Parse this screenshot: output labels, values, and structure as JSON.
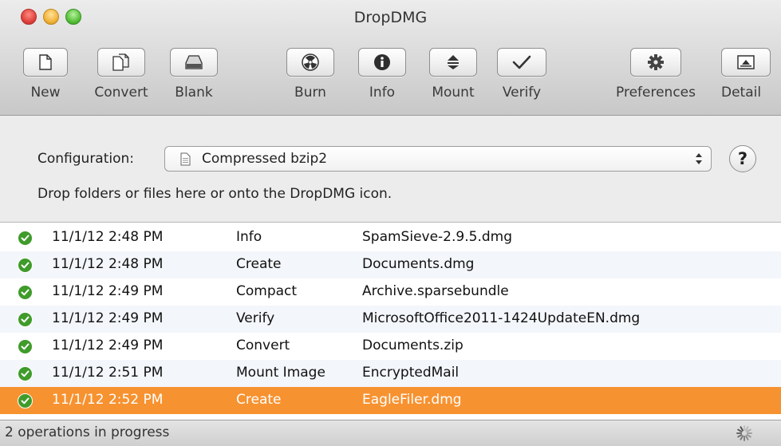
{
  "window": {
    "title": "DropDMG"
  },
  "toolbar": {
    "items": [
      {
        "label": "New",
        "icon": "new-document-icon"
      },
      {
        "label": "Convert",
        "icon": "convert-documents-icon"
      },
      {
        "label": "Blank",
        "icon": "blank-disk-icon"
      },
      {
        "label": "Burn",
        "icon": "burn-radiation-icon"
      },
      {
        "label": "Info",
        "icon": "info-icon"
      },
      {
        "label": "Mount",
        "icon": "mount-eject-icon"
      },
      {
        "label": "Verify",
        "icon": "checkmark-icon"
      },
      {
        "label": "Preferences",
        "icon": "gear-icon"
      },
      {
        "label": "Detail",
        "icon": "detail-window-icon"
      }
    ]
  },
  "config": {
    "label": "Configuration:",
    "selected": "Compressed bzip2",
    "help_label": "?",
    "drop_hint": "Drop folders or files here or onto the DropDMG icon."
  },
  "log": {
    "rows": [
      {
        "time": "11/1/12 2:48 PM",
        "operation": "Info",
        "file": "SpamSieve-2.9.5.dmg",
        "status": "success"
      },
      {
        "time": "11/1/12 2:48 PM",
        "operation": "Create",
        "file": "Documents.dmg",
        "status": "success"
      },
      {
        "time": "11/1/12 2:49 PM",
        "operation": "Compact",
        "file": "Archive.sparsebundle",
        "status": "success"
      },
      {
        "time": "11/1/12 2:49 PM",
        "operation": "Verify",
        "file": "MicrosoftOffice2011-1424UpdateEN.dmg",
        "status": "success"
      },
      {
        "time": "11/1/12 2:49 PM",
        "operation": "Convert",
        "file": "Documents.zip",
        "status": "success"
      },
      {
        "time": "11/1/12 2:51 PM",
        "operation": "Mount Image",
        "file": "EncryptedMail",
        "status": "success"
      },
      {
        "time": "11/1/12 2:52 PM",
        "operation": "Create",
        "file": "EagleFiler.dmg",
        "status": "success"
      }
    ],
    "selected_index": 6
  },
  "status": {
    "text": "2 operations in progress"
  },
  "colors": {
    "selection": "#f79230",
    "success": "#3f9b2a"
  }
}
